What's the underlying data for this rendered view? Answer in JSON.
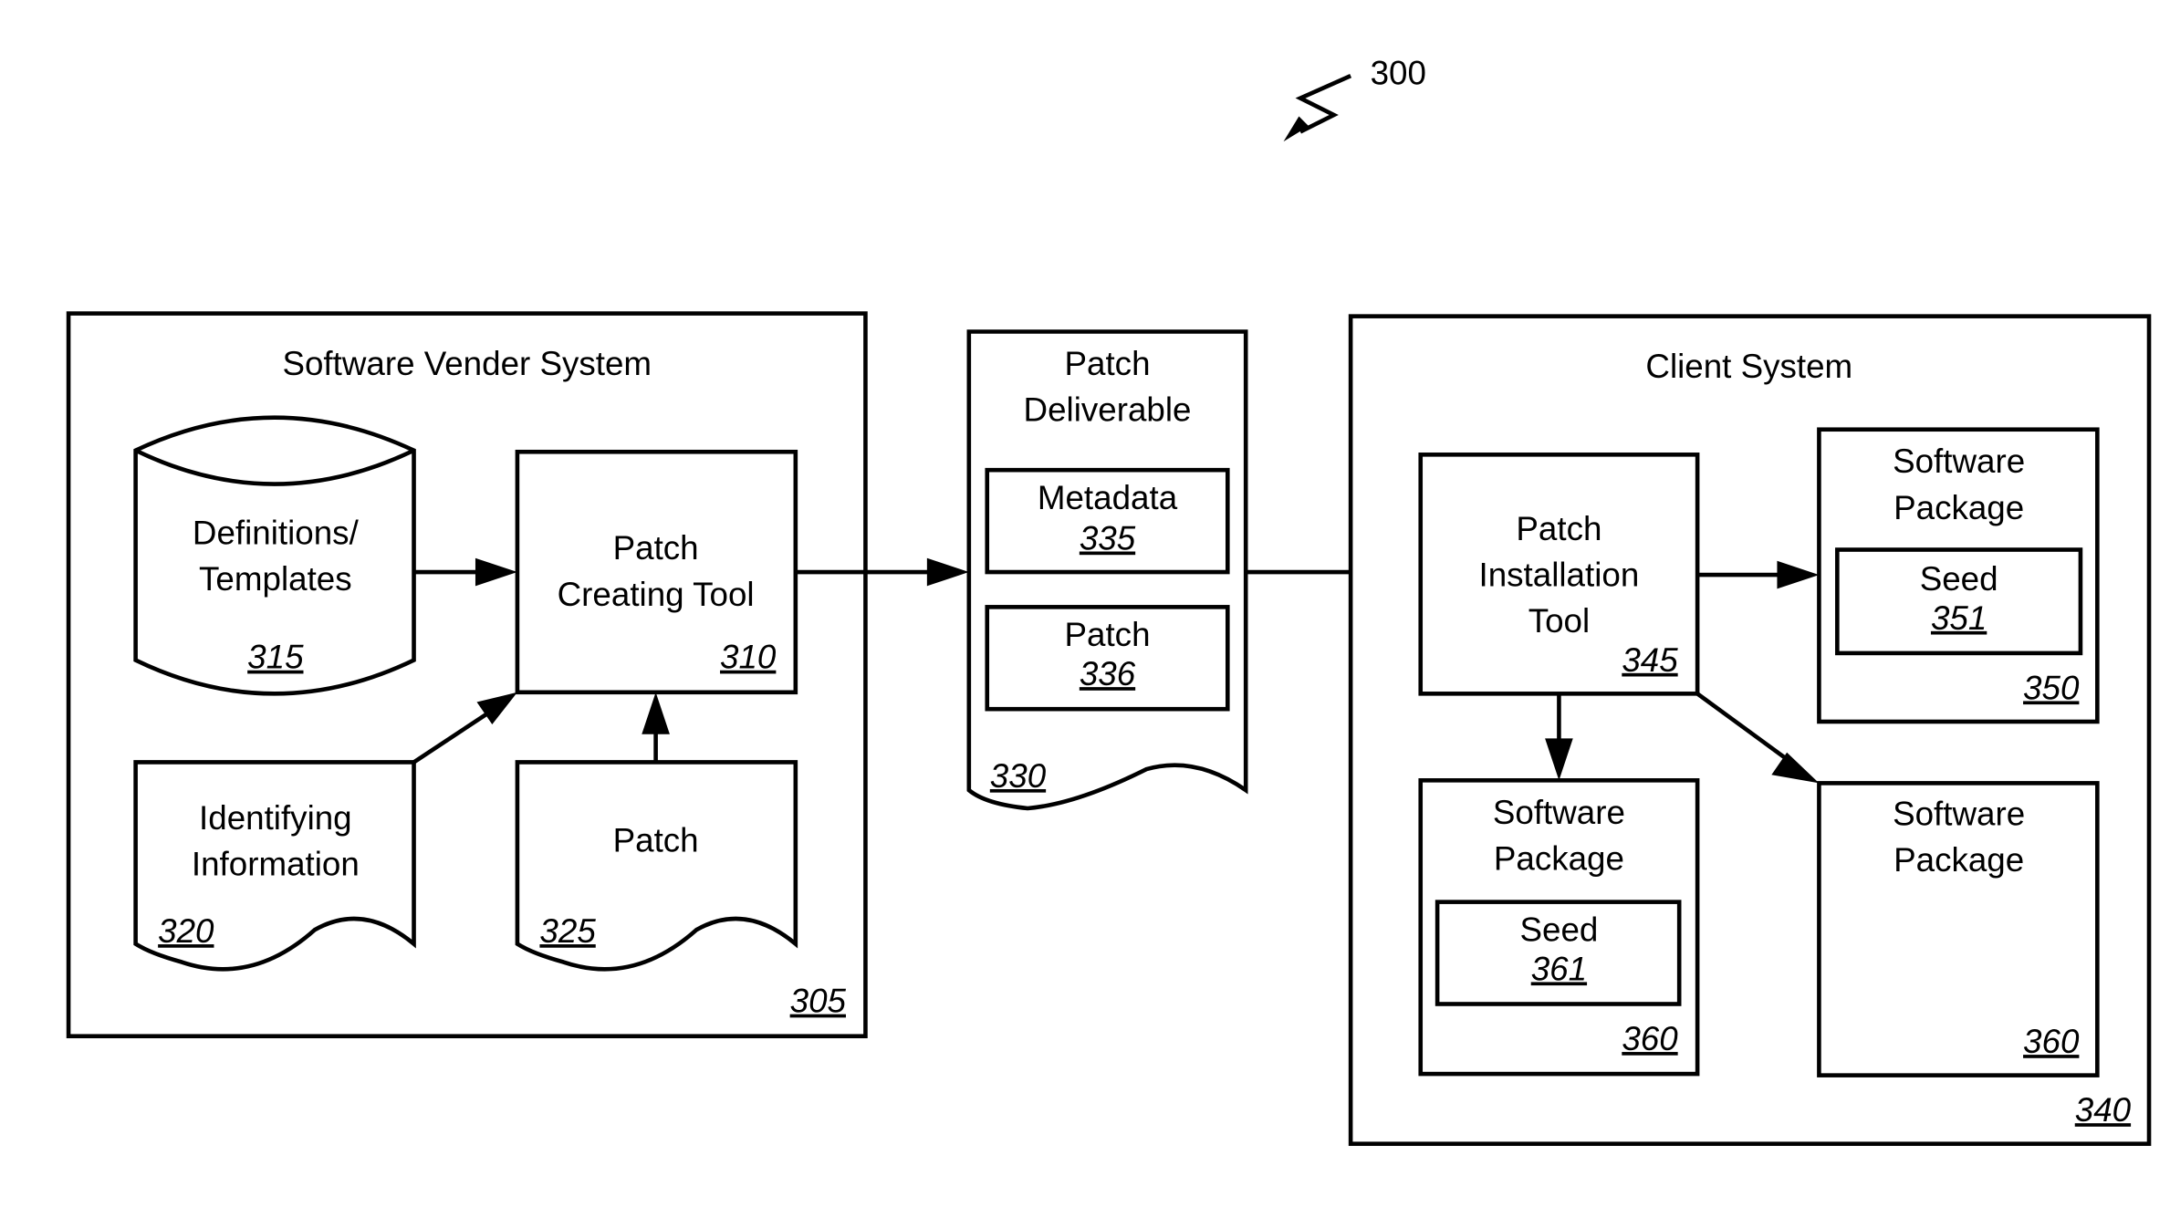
{
  "figure_ref": "300",
  "vendor_system": {
    "title": "Software Vender System",
    "ref": "305",
    "definitions": {
      "line1": "Definitions/",
      "line2": "Templates",
      "ref": "315"
    },
    "creating_tool": {
      "line1": "Patch",
      "line2": "Creating Tool",
      "ref": "310"
    },
    "identifying_info": {
      "line1": "Identifying",
      "line2": "Information",
      "ref": "320"
    },
    "patch": {
      "label": "Patch",
      "ref": "325"
    }
  },
  "deliverable": {
    "line1": "Patch",
    "line2": "Deliverable",
    "ref": "330",
    "metadata": {
      "label": "Metadata",
      "ref": "335"
    },
    "patch": {
      "label": "Patch",
      "ref": "336"
    }
  },
  "client_system": {
    "title": "Client System",
    "ref": "340",
    "install_tool": {
      "line1": "Patch",
      "line2": "Installation",
      "line3": "Tool",
      "ref": "345"
    },
    "package_a": {
      "line1": "Software",
      "line2": "Package",
      "ref": "350",
      "seed": {
        "label": "Seed",
        "ref": "351"
      }
    },
    "package_b": {
      "line1": "Software",
      "line2": "Package",
      "ref": "360",
      "seed": {
        "label": "Seed",
        "ref": "361"
      }
    },
    "package_c": {
      "line1": "Software",
      "line2": "Package",
      "ref": "360"
    }
  }
}
